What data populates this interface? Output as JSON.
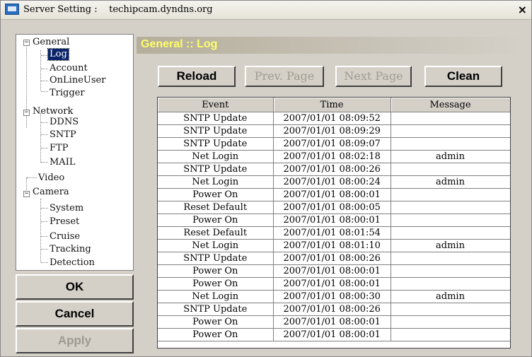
{
  "window": {
    "title": "Server Setting :    techipcam.dyndns.org",
    "close_label": "×"
  },
  "tree": {
    "general": "General",
    "log": "Log",
    "account": "Account",
    "onlineuser": "OnLineUser",
    "trigger": "Trigger",
    "network": "Network",
    "ddns": "DDNS",
    "sntp": "SNTP",
    "ftp": "FTP",
    "mail": "MAIL",
    "video": "Video",
    "camera": "Camera",
    "system": "System",
    "preset": "Preset",
    "cruise": "Cruise",
    "tracking": "Tracking",
    "detection": "Detection"
  },
  "buttons": {
    "ok": "OK",
    "cancel": "Cancel",
    "apply": "Apply",
    "reload": "Reload",
    "prev_page": "Prev. Page",
    "next_page": "Next Page",
    "clean": "Clean"
  },
  "section_title": "General :: Log",
  "log_table": {
    "columns": [
      "Event",
      "Time",
      "Message"
    ],
    "rows": [
      {
        "event": "SNTP Update",
        "time": "2007/01/01 08:09:52",
        "message": ""
      },
      {
        "event": "SNTP Update",
        "time": "2007/01/01 08:09:29",
        "message": ""
      },
      {
        "event": "SNTP Update",
        "time": "2007/01/01 08:09:07",
        "message": ""
      },
      {
        "event": "Net Login",
        "time": "2007/01/01 08:02:18",
        "message": "admin"
      },
      {
        "event": "SNTP Update",
        "time": "2007/01/01 08:00:26",
        "message": ""
      },
      {
        "event": "Net Login",
        "time": "2007/01/01 08:00:24",
        "message": "admin"
      },
      {
        "event": "Power On",
        "time": "2007/01/01 08:00:01",
        "message": ""
      },
      {
        "event": "Reset Default",
        "time": "2007/01/01 08:00:05",
        "message": ""
      },
      {
        "event": "Power On",
        "time": "2007/01/01 08:00:01",
        "message": ""
      },
      {
        "event": "Reset Default",
        "time": "2007/01/01 08:01:54",
        "message": ""
      },
      {
        "event": "Net Login",
        "time": "2007/01/01 08:01:10",
        "message": "admin"
      },
      {
        "event": "SNTP Update",
        "time": "2007/01/01 08:00:26",
        "message": ""
      },
      {
        "event": "Power On",
        "time": "2007/01/01 08:00:01",
        "message": ""
      },
      {
        "event": "Power On",
        "time": "2007/01/01 08:00:01",
        "message": ""
      },
      {
        "event": "Net Login",
        "time": "2007/01/01 08:00:30",
        "message": "admin"
      },
      {
        "event": "SNTP Update",
        "time": "2007/01/01 08:00:26",
        "message": ""
      },
      {
        "event": "Power On",
        "time": "2007/01/01 08:00:01",
        "message": ""
      },
      {
        "event": "Power On",
        "time": "2007/01/01 08:00:01",
        "message": ""
      }
    ]
  },
  "colors": {
    "dialog_background": "#d4d0c8",
    "selection": "#0a246a",
    "section_title_text": "#ffff66"
  }
}
